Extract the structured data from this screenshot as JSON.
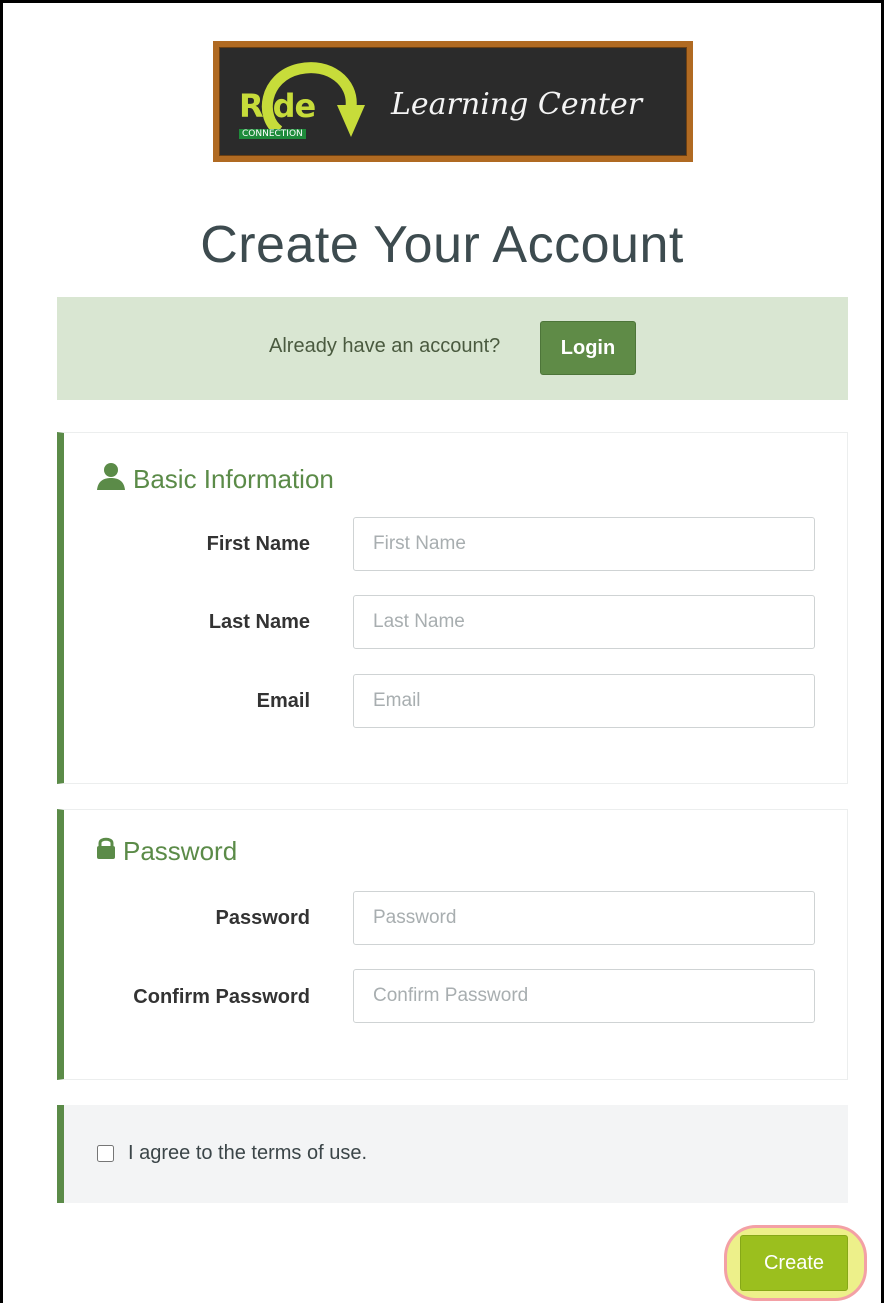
{
  "brand": {
    "logo_ride": "Ride",
    "logo_connection": "CONNECTION",
    "logo_title": "Learning Center",
    "colors": {
      "board": "#2b2b2b",
      "frame": "#b06a22",
      "ride_green": "#c7dc3a"
    }
  },
  "page": {
    "title": "Create Your Account"
  },
  "login_banner": {
    "prompt": "Already have an account?",
    "button_label": "Login"
  },
  "basic_info": {
    "title": "Basic Information",
    "icon": "user-icon",
    "fields": {
      "first_name": {
        "label": "First Name",
        "placeholder": "First Name",
        "value": ""
      },
      "last_name": {
        "label": "Last Name",
        "placeholder": "Last Name",
        "value": ""
      },
      "email": {
        "label": "Email",
        "placeholder": "Email",
        "value": ""
      }
    }
  },
  "password_section": {
    "title": "Password",
    "icon": "lock-icon",
    "fields": {
      "password": {
        "label": "Password",
        "placeholder": "Password",
        "value": ""
      },
      "confirm_password": {
        "label": "Confirm Password",
        "placeholder": "Confirm Password",
        "value": ""
      }
    }
  },
  "terms": {
    "label": "I agree to the terms of use.",
    "checked": false
  },
  "actions": {
    "create_label": "Create"
  },
  "colors": {
    "accent_green": "#5b8b48",
    "create_green": "#9bbf1e",
    "banner_bg": "#d9e6d2"
  }
}
